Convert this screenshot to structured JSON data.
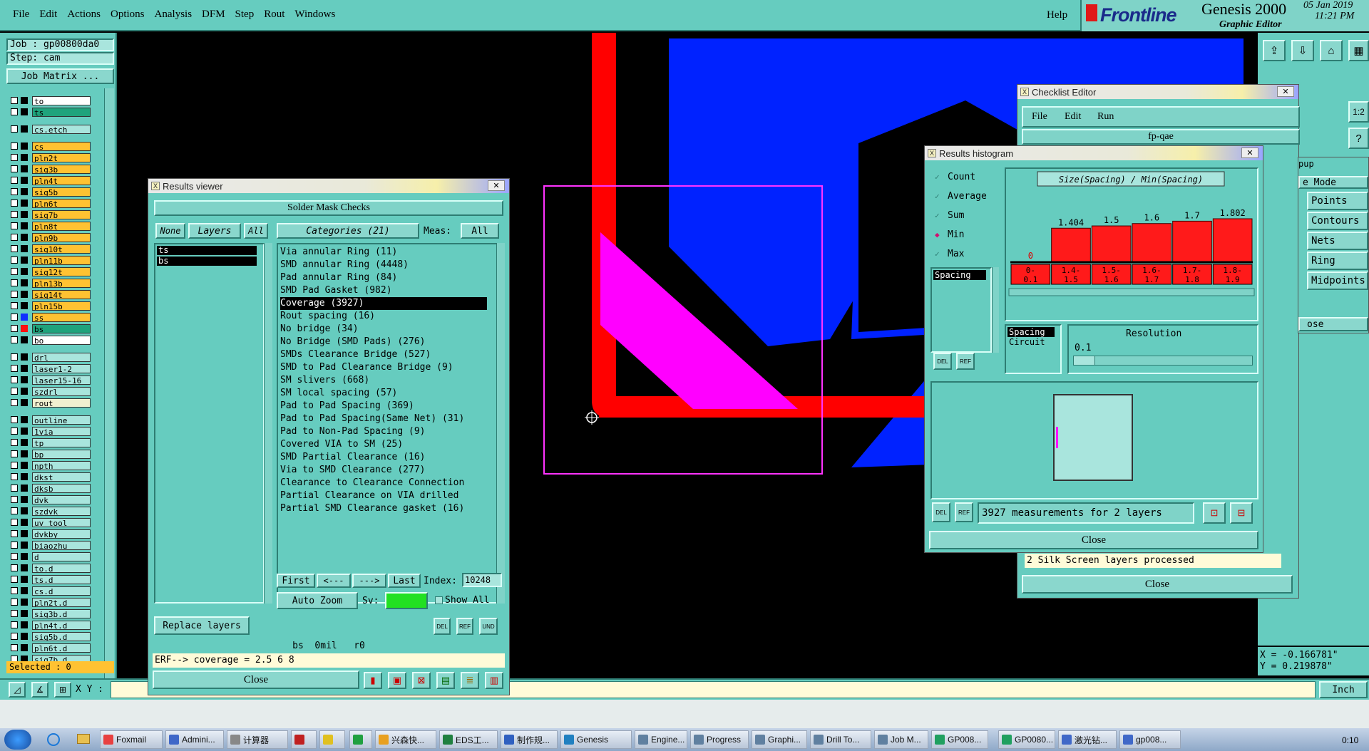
{
  "menu": {
    "items": [
      "File",
      "Edit",
      "Actions",
      "Options",
      "Analysis",
      "DFM",
      "Step",
      "Rout",
      "Windows"
    ],
    "help": "Help"
  },
  "brand": {
    "logo": "Frontline",
    "product": "Genesis 2000",
    "subtitle": "Graphic Editor",
    "date": "05 Jan 2019",
    "time": "11:21 PM"
  },
  "job": {
    "job_label": "Job : gp00800da0",
    "step_label": "Step: cam",
    "matrix_button": "Job Matrix ...",
    "selected": "Selected : 0"
  },
  "layers": [
    {
      "name": "to",
      "color": "#ffffff",
      "swatch": "#000000"
    },
    {
      "name": "ts",
      "color": "#1fa37c",
      "swatch": "#000000"
    },
    {
      "name": "cs.etch",
      "color": "#a9e5dd",
      "swatch": "#000000"
    },
    {
      "name": "cs",
      "color": "#ffc232",
      "swatch": "#000000"
    },
    {
      "name": "pln2t",
      "color": "#ffc232",
      "swatch": "#000000"
    },
    {
      "name": "sig3b",
      "color": "#ffc232",
      "swatch": "#000000"
    },
    {
      "name": "pln4t",
      "color": "#ffc232",
      "swatch": "#000000"
    },
    {
      "name": "sig5b",
      "color": "#ffc232",
      "swatch": "#000000"
    },
    {
      "name": "pln6t",
      "color": "#ffc232",
      "swatch": "#000000"
    },
    {
      "name": "sig7b",
      "color": "#ffc232",
      "swatch": "#000000"
    },
    {
      "name": "pln8t",
      "color": "#ffc232",
      "swatch": "#000000"
    },
    {
      "name": "pln9b",
      "color": "#ffc232",
      "swatch": "#000000"
    },
    {
      "name": "sig10t",
      "color": "#ffc232",
      "swatch": "#000000"
    },
    {
      "name": "pln11b",
      "color": "#ffc232",
      "swatch": "#000000"
    },
    {
      "name": "sig12t",
      "color": "#ffc232",
      "swatch": "#000000"
    },
    {
      "name": "pln13b",
      "color": "#ffc232",
      "swatch": "#000000"
    },
    {
      "name": "sig14t",
      "color": "#ffc232",
      "swatch": "#000000"
    },
    {
      "name": "pln15b",
      "color": "#ffc232",
      "swatch": "#000000"
    },
    {
      "name": "ss",
      "color": "#ffc232",
      "swatch": "#1030ff"
    },
    {
      "name": "bs",
      "color": "#1fa37c",
      "swatch": "#ff1010"
    },
    {
      "name": "bo",
      "color": "#ffffff",
      "swatch": "#000000"
    },
    {
      "name": "drl",
      "color": "#a9e5dd",
      "swatch": "#000000"
    },
    {
      "name": "laser1-2",
      "color": "#a9e5dd",
      "swatch": "#000000"
    },
    {
      "name": "laser15-16",
      "color": "#a9e5dd",
      "swatch": "#000000"
    },
    {
      "name": "szdrl",
      "color": "#a9e5dd",
      "swatch": "#000000"
    },
    {
      "name": "rout",
      "color": "#f0f0d0",
      "swatch": "#000000"
    },
    {
      "name": "outline",
      "color": "#a9e5dd",
      "swatch": "#000000"
    },
    {
      "name": "1via",
      "color": "#a9e5dd",
      "swatch": "#000000"
    },
    {
      "name": "tp",
      "color": "#a9e5dd",
      "swatch": "#000000"
    },
    {
      "name": "bp",
      "color": "#a9e5dd",
      "swatch": "#000000"
    },
    {
      "name": "npth",
      "color": "#a9e5dd",
      "swatch": "#000000"
    },
    {
      "name": "dkst",
      "color": "#a9e5dd",
      "swatch": "#000000"
    },
    {
      "name": "dksb",
      "color": "#a9e5dd",
      "swatch": "#000000"
    },
    {
      "name": "dvk",
      "color": "#a9e5dd",
      "swatch": "#000000"
    },
    {
      "name": "szdvk",
      "color": "#a9e5dd",
      "swatch": "#000000"
    },
    {
      "name": "uv_tool",
      "color": "#a9e5dd",
      "swatch": "#000000"
    },
    {
      "name": "dvkby",
      "color": "#a9e5dd",
      "swatch": "#000000"
    },
    {
      "name": "biaozhu",
      "color": "#a9e5dd",
      "swatch": "#000000"
    },
    {
      "name": "d",
      "color": "#a9e5dd",
      "swatch": "#000000"
    },
    {
      "name": "to.d",
      "color": "#a9e5dd",
      "swatch": "#000000"
    },
    {
      "name": "ts.d",
      "color": "#a9e5dd",
      "swatch": "#000000"
    },
    {
      "name": "cs.d",
      "color": "#a9e5dd",
      "swatch": "#000000"
    },
    {
      "name": "pln2t.d",
      "color": "#a9e5dd",
      "swatch": "#000000"
    },
    {
      "name": "sig3b.d",
      "color": "#a9e5dd",
      "swatch": "#000000"
    },
    {
      "name": "pln4t.d",
      "color": "#a9e5dd",
      "swatch": "#000000"
    },
    {
      "name": "sig5b.d",
      "color": "#a9e5dd",
      "swatch": "#000000"
    },
    {
      "name": "pln6t.d",
      "color": "#a9e5dd",
      "swatch": "#000000"
    },
    {
      "name": "sig7b.d",
      "color": "#a9e5dd",
      "swatch": "#000000"
    }
  ],
  "results_viewer": {
    "title": "Results viewer",
    "header": "Solder Mask Checks",
    "none_btn": "None",
    "layers_btn": "Layers",
    "all_btn": "All",
    "categories_btn": "Categories (21)",
    "meas_label": "Meas:",
    "meas_value": "All",
    "layer_list": [
      "ts",
      "bs"
    ],
    "categories": [
      "Via annular Ring (11)",
      "SMD annular Ring (4448)",
      "Pad annular Ring (84)",
      "SMD Pad Gasket (982)",
      "Coverage (3927)",
      "Rout spacing (16)",
      "No bridge (34)",
      "No Bridge (SMD Pads) (276)",
      "SMDs Clearance Bridge (527)",
      "SMD to Pad Clearance Bridge (9)",
      "SM slivers (668)",
      "SM local spacing (57)",
      "Pad to Pad Spacing (369)",
      "Pad to Pad Spacing(Same Net) (31)",
      "Pad to Non-Pad Spacing (9)",
      "Covered VIA to SM (25)",
      "SMD Partial Clearance (16)",
      "Via to SMD Clearance (277)",
      "Clearance to Clearance Connection",
      "Partial Clearance on VIA drilled",
      "Partial SMD Clearance gasket (16)"
    ],
    "first": "First",
    "prev": "<---",
    "next": "--->",
    "last": "Last",
    "index_label": "Index:",
    "index_value": "10248",
    "auto_zoom": "Auto Zoom",
    "sv_label": "Sv:",
    "show_all": "Show All",
    "replace_layers": "Replace layers",
    "status_line": "bs  0mil   r0",
    "erf_line": "ERF--> coverage = 2.5 6 8",
    "close": "Close"
  },
  "checklist": {
    "title": "Checklist Editor",
    "menu": [
      "File",
      "Edit",
      "Run"
    ],
    "name": "fp-qae",
    "message": "2 Silk Screen layers processed",
    "close": "Close"
  },
  "popup": {
    "title_frag": "pup",
    "items": [
      "e Mode",
      "Points",
      "Contours",
      "Nets",
      "Ring",
      "Midpoints"
    ],
    "close_frag": "ose"
  },
  "histogram": {
    "title": "Results histogram",
    "options": [
      "Count",
      "Average",
      "Sum",
      "Min",
      "Max"
    ],
    "selected_option": "Min",
    "list_item": "Spacing",
    "chart_title": "Size(Spacing) / Min(Spacing)",
    "bins": [
      "0-\n0.1",
      "1.4-\n1.5",
      "1.5-\n1.6",
      "1.6-\n1.7",
      "1.7-\n1.8",
      "1.8-\n1.9"
    ],
    "values": [
      0,
      1.404,
      1.5,
      1.6,
      1.7,
      1.802
    ],
    "value_labels": [
      "0",
      "1.404",
      "1.5",
      "1.6",
      "1.7",
      "1.802"
    ],
    "types": [
      "Spacing",
      "Circuit"
    ],
    "resolution_label": "Resolution",
    "resolution_value": "0.1",
    "measurements": "3927 measurements for 2 layers",
    "close": "Close",
    "del": "DEL",
    "ref": "REF"
  },
  "chart_data": {
    "type": "bar",
    "title": "Size(Spacing) / Min(Spacing)",
    "categories": [
      "0-0.1",
      "1.4-1.5",
      "1.5-1.6",
      "1.6-1.7",
      "1.7-1.8",
      "1.8-1.9"
    ],
    "values": [
      0,
      1.404,
      1.5,
      1.6,
      1.7,
      1.802
    ],
    "xlabel": "",
    "ylabel": "",
    "bar_color": "#ff1a1a"
  },
  "coords": {
    "x": "X = -0.166781\"",
    "y": "Y = 0.219878\"",
    "units": "Inch"
  },
  "bottom_bar": {
    "xy_label": "X Y :"
  },
  "taskbar": {
    "items": [
      "Foxmail",
      "Admini...",
      "计算器",
      "",
      "",
      "",
      "兴森快...",
      "EDS工...",
      "制作规...",
      "Genesis",
      "Engine...",
      "Progress",
      "Graphi...",
      "Drill To...",
      "Job M...",
      "GP008...",
      "GP0080...",
      "激光钻...",
      "gp008..."
    ],
    "clock": "0:10"
  },
  "colors": {
    "teal": "#66ccbf",
    "canvas": "#000000",
    "copper_red": "#ff0000",
    "pad_blue": "#0022ff",
    "mask_magenta": "#ff00ff"
  }
}
